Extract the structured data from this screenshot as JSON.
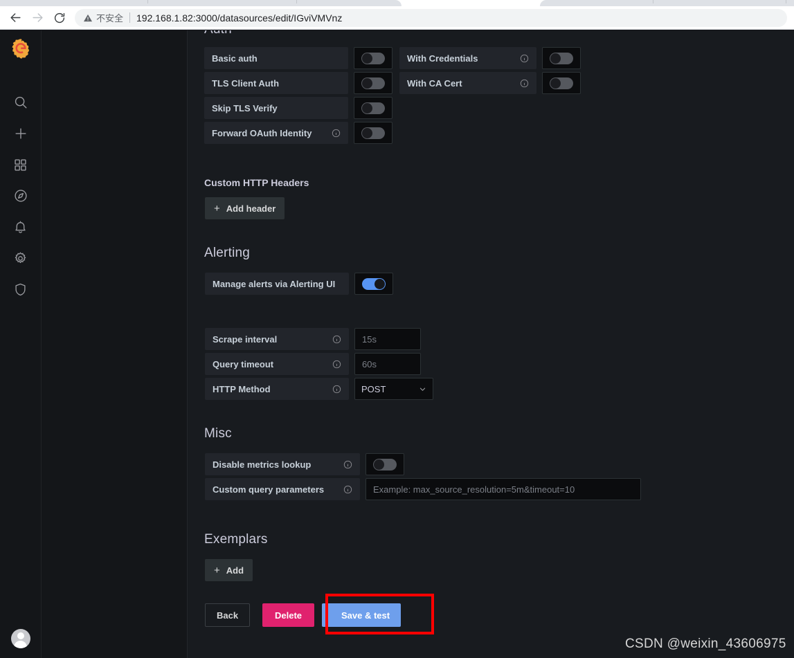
{
  "browser": {
    "back_icon": "arrow-left-icon",
    "forward_icon": "arrow-right-icon",
    "reload_icon": "reload-icon",
    "security_icon": "warning-triangle-icon",
    "security_label": "不安全",
    "url": "192.168.1.82:3000/datasources/edit/IGviVMVnz"
  },
  "sidebar": {
    "logo": "grafana-logo-icon",
    "items": [
      {
        "icon": "search-icon",
        "name": "search"
      },
      {
        "icon": "plus-icon",
        "name": "create"
      },
      {
        "icon": "dashboards-icon",
        "name": "dashboards"
      },
      {
        "icon": "compass-icon",
        "name": "explore"
      },
      {
        "icon": "bell-icon",
        "name": "alerting"
      },
      {
        "icon": "gear-icon",
        "name": "configuration"
      },
      {
        "icon": "shield-icon",
        "name": "server-admin"
      }
    ],
    "avatar": "user-avatar"
  },
  "page": {
    "auth": {
      "title": "Auth",
      "left_rows": [
        {
          "label": "Basic auth",
          "info": false,
          "toggle": false
        },
        {
          "label": "TLS Client Auth",
          "info": false,
          "toggle": false
        },
        {
          "label": "Skip TLS Verify",
          "info": false,
          "toggle": false
        },
        {
          "label": "Forward OAuth Identity",
          "info": true,
          "toggle": false
        }
      ],
      "right_rows": [
        {
          "label": "With Credentials",
          "info": true,
          "toggle": false
        },
        {
          "label": "With CA Cert",
          "info": true,
          "toggle": false
        }
      ]
    },
    "custom_headers": {
      "title": "Custom HTTP Headers",
      "add_button": "Add header",
      "plus": "+"
    },
    "alerting": {
      "title": "Alerting",
      "manage_label": "Manage alerts via Alerting UI",
      "manage_toggle": true
    },
    "intervals": {
      "scrape_label": "Scrape interval",
      "scrape_placeholder": "15s",
      "query_label": "Query timeout",
      "query_placeholder": "60s",
      "method_label": "HTTP Method",
      "method_value": "POST",
      "chevron": "chevron-down-icon"
    },
    "misc": {
      "title": "Misc",
      "disable_lookup_label": "Disable metrics lookup",
      "disable_lookup_toggle": false,
      "custom_params_label": "Custom query parameters",
      "custom_params_placeholder": "Example: max_source_resolution=5m&timeout=10"
    },
    "exemplars": {
      "title": "Exemplars",
      "add_button": "Add",
      "plus": "+"
    },
    "actions": {
      "back": "Back",
      "delete": "Delete",
      "save_test": "Save & test"
    }
  },
  "annotation": {
    "highlight_color": "#fe0000",
    "target": "save-and-test-button"
  },
  "watermark": "CSDN @weixin_43606975",
  "colors": {
    "accent_blue": "#6e9fec",
    "toggle_on": "#5794f2",
    "danger_pink": "#e0226e",
    "panel_bg": "#181b1f",
    "sidebar_bg": "#141619",
    "field_bg": "#22252b"
  }
}
